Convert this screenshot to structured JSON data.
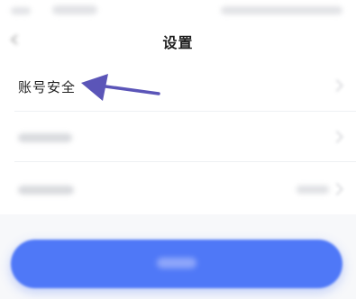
{
  "header": {
    "title": "设置"
  },
  "rows": [
    {
      "label": "账号安全"
    }
  ],
  "annotation": {
    "color": "#5b55b8"
  },
  "colors": {
    "primary_button": "#4f78f7"
  },
  "icons": {
    "back": "back-arrow-icon",
    "chevron": "chevron-right-icon"
  }
}
